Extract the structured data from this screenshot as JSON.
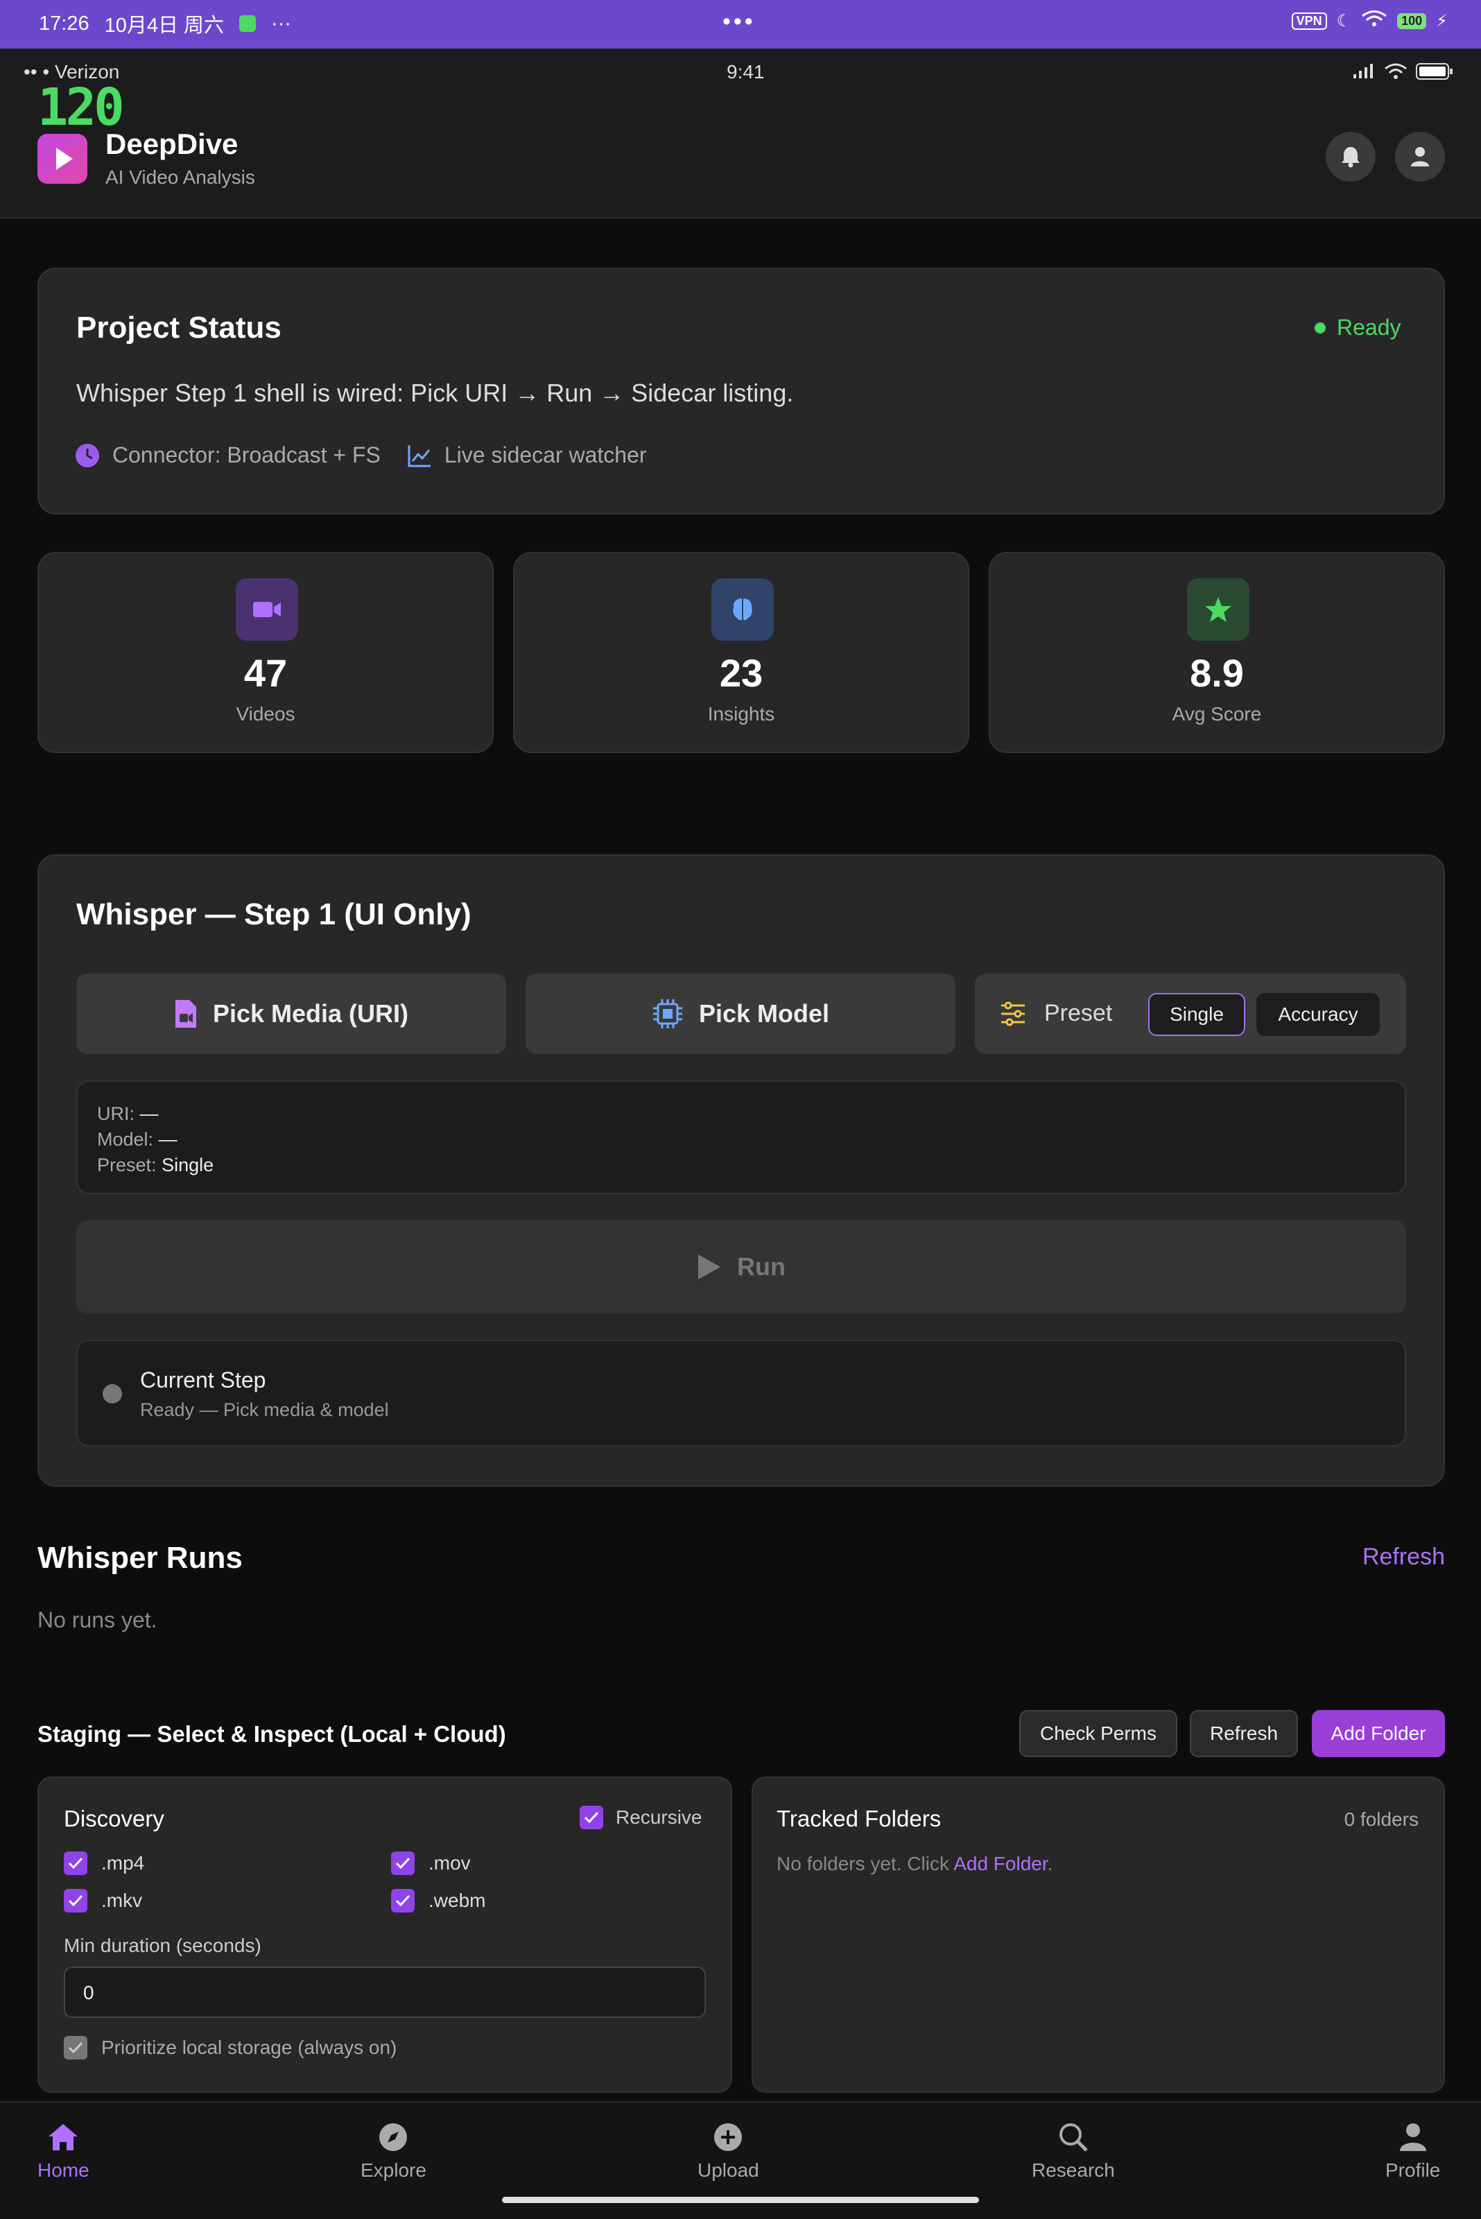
{
  "system_bar": {
    "time": "17:26",
    "date": "10月4日 周六",
    "dots": "···",
    "center": "•••",
    "vpn": "VPN",
    "battery": "100"
  },
  "ios_bar": {
    "carrier": "Verizon",
    "time": "9:41"
  },
  "fps": "120",
  "app": {
    "title": "DeepDive",
    "subtitle": "AI Video Analysis"
  },
  "project_status": {
    "title": "Project Status",
    "status": "Ready",
    "description": "Whisper Step 1 shell is wired: Pick URI → Run → Sidecar listing.",
    "connector": "Connector: Broadcast + FS",
    "watcher": "Live sidecar watcher"
  },
  "stats": [
    {
      "value": "47",
      "label": "Videos"
    },
    {
      "value": "23",
      "label": "Insights"
    },
    {
      "value": "8.9",
      "label": "Avg Score"
    }
  ],
  "whisper": {
    "title": "Whisper — Step 1 (UI Only)",
    "pick_media": "Pick Media (URI)",
    "pick_model": "Pick Model",
    "preset_label": "Preset",
    "preset_options": [
      "Single",
      "Accuracy"
    ],
    "selected_preset": "Single",
    "uri_label": "URI:",
    "uri_value": "—",
    "model_label": "Model:",
    "model_value": "—",
    "preset_info_label": "Preset:",
    "preset_info_value": "Single",
    "run": "Run",
    "current_step_title": "Current Step",
    "current_step_detail": "Ready — Pick media & model"
  },
  "runs": {
    "title": "Whisper Runs",
    "refresh": "Refresh",
    "empty": "No runs yet."
  },
  "staging": {
    "title": "Staging — Select & Inspect (Local + Cloud)",
    "check_perms": "Check Perms",
    "refresh": "Refresh",
    "add_folder": "Add Folder",
    "discovery": {
      "title": "Discovery",
      "recursive": "Recursive",
      "extensions": [
        ".mp4",
        ".mov",
        ".mkv",
        ".webm"
      ],
      "min_duration_label": "Min duration (seconds)",
      "min_duration_value": "0",
      "prioritize": "Prioritize local storage (always on)"
    },
    "tracked": {
      "title": "Tracked Folders",
      "count": "0 folders",
      "empty_prefix": "No folders yet. Click",
      "empty_link": "Add Folder",
      "empty_suffix": "."
    }
  },
  "nav": [
    {
      "label": "Home"
    },
    {
      "label": "Explore"
    },
    {
      "label": "Upload"
    },
    {
      "label": "Research"
    },
    {
      "label": "Profile"
    }
  ],
  "colors": {
    "accent": "#b070ff",
    "ready": "#4cd964",
    "header_bar": "#6c48cc"
  }
}
